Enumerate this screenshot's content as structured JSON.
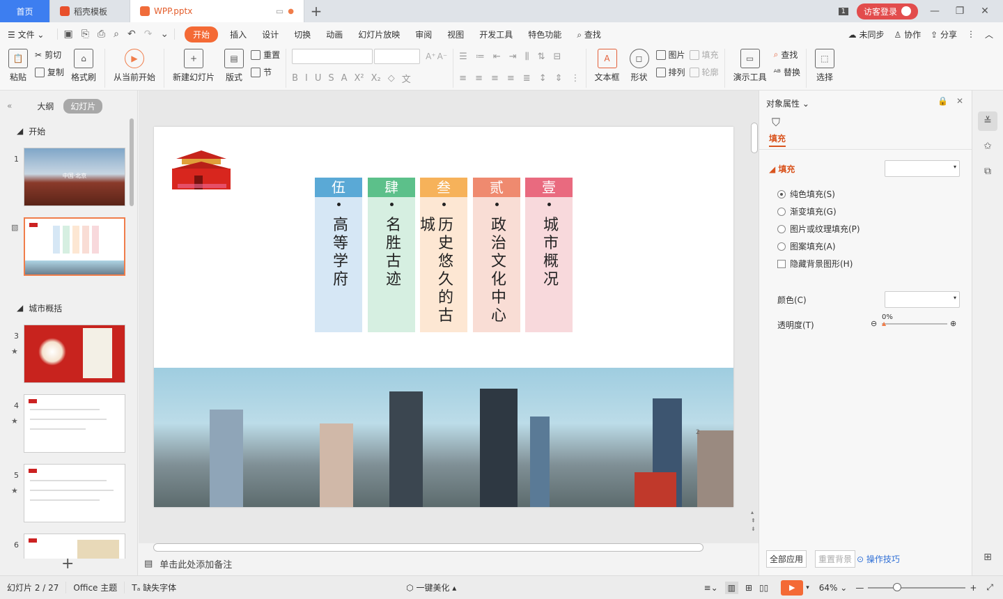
{
  "tabs": {
    "home": "首页",
    "template": "稻壳模板",
    "file": "WPP.pptx"
  },
  "titlebar": {
    "count": "1",
    "visitor": "访客登录"
  },
  "menu": {
    "file": "文件",
    "items": [
      "开始",
      "插入",
      "设计",
      "切换",
      "动画",
      "幻灯片放映",
      "审阅",
      "视图",
      "开发工具",
      "特色功能"
    ],
    "search": "查找",
    "unsync": "未同步",
    "collab": "协作",
    "share": "分享"
  },
  "ribbon": {
    "paste": "粘贴",
    "cut": "剪切",
    "copy": "复制",
    "format_painter": "格式刷",
    "from_current": "从当前开始",
    "new_slide": "新建幻灯片",
    "layout": "版式",
    "reset": "重置",
    "section": "节",
    "textbox": "文本框",
    "shape": "形状",
    "picture": "图片",
    "fill": "填充",
    "arrange": "排列",
    "outline": "轮廓",
    "presenter_tools": "演示工具",
    "find": "查找",
    "replace": "替换",
    "select": "选择"
  },
  "leftpanel": {
    "tab_outline": "大纲",
    "tab_slides": "幻灯片",
    "section1": "开始",
    "section2": "城市概括",
    "thumbs": [
      {
        "num": "1",
        "title": "中国·北京"
      },
      {
        "num": ""
      },
      {
        "num": "3"
      },
      {
        "num": "4"
      },
      {
        "num": "5"
      },
      {
        "num": "6"
      }
    ]
  },
  "slide": {
    "columns": [
      {
        "head": "伍",
        "text": "高等学府",
        "color": "#5aa9d6",
        "bg": "#d6e7f5"
      },
      {
        "head": "肆",
        "text": "名胜古迹",
        "color": "#5cc08a",
        "bg": "#d6efe1"
      },
      {
        "head": "叁",
        "text": "历史悠久的古",
        "extra": "城",
        "color": "#f6b25a",
        "bg": "#fde7d3"
      },
      {
        "head": "贰",
        "text": "政治文化中心",
        "color": "#ef8a6f",
        "bg": "#f9ddd5"
      },
      {
        "head": "壹",
        "text": "城市概况",
        "color": "#e96a7f",
        "bg": "#f8d9dc"
      }
    ],
    "page_marker": "2"
  },
  "notes": {
    "placeholder": "单击此处添加备注"
  },
  "rightpanel": {
    "title": "对象属性",
    "fill_tab": "填充",
    "fill_section": "填充",
    "options": [
      "纯色填充(S)",
      "渐变填充(G)",
      "图片或纹理填充(P)",
      "图案填充(A)"
    ],
    "hide_bg": "隐藏背景图形(H)",
    "color_label": "颜色(C)",
    "transparency_label": "透明度(T)",
    "transparency_value": "0%",
    "apply_all": "全部应用",
    "reset_bg": "重置背景",
    "tips": "操作技巧"
  },
  "status": {
    "slide_info": "幻灯片 2 / 27",
    "theme": "Office 主题",
    "missing_font": "缺失字体",
    "beautify": "一键美化",
    "zoom": "64%"
  }
}
